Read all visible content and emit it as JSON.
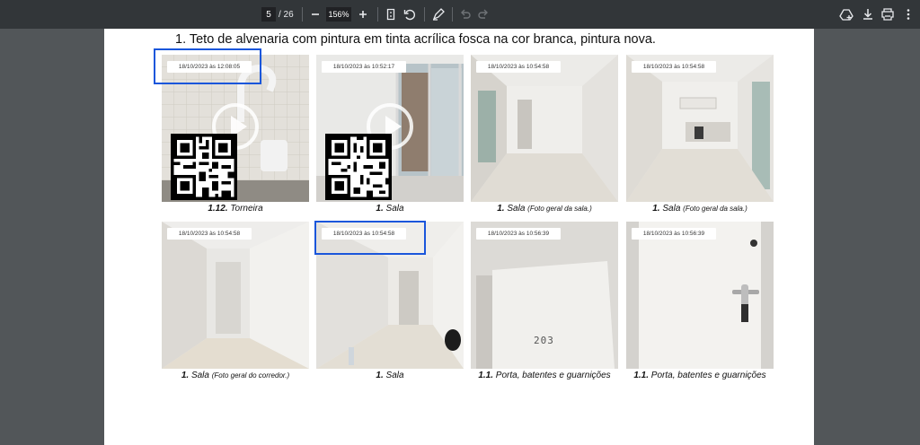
{
  "toolbar": {
    "current_page": "5",
    "page_total": "/ 26",
    "zoom": "156%",
    "icons": [
      "menu-icon",
      "zoom-out-icon",
      "zoom-in-icon",
      "fit-page-icon",
      "rotate-icon",
      "annotate-icon",
      "undo-icon",
      "redo-icon",
      "save-to-drive-icon",
      "download-icon",
      "print-icon",
      "more-options-icon"
    ]
  },
  "document": {
    "heading": "1. Teto de alvenaria com pintura em tinta acrílica fosca na cor branca, pintura nova.",
    "photos": [
      {
        "timestamp": "18/10/2023 às 12:08:05",
        "num": "1.12.",
        "title": "Torneira",
        "sub": ""
      },
      {
        "timestamp": "18/10/2023 às 10:52:17",
        "num": "1.",
        "title": "Sala",
        "sub": ""
      },
      {
        "timestamp": "18/10/2023 às 10:54:58",
        "num": "1.",
        "title": "Sala",
        "sub": "(Foto geral da sala.)"
      },
      {
        "timestamp": "18/10/2023 às 10:54:58",
        "num": "1.",
        "title": "Sala",
        "sub": "(Foto geral da sala.)"
      },
      {
        "timestamp": "18/10/2023 às 10:54:58",
        "num": "1.",
        "title": "Sala",
        "sub": "(Foto geral do corredor.)"
      },
      {
        "timestamp": "18/10/2023 às 10:54:58",
        "num": "1.",
        "title": "Sala",
        "sub": ""
      },
      {
        "timestamp": "18/10/2023 às 10:56:39",
        "num": "1.1.",
        "title": "Porta, batentes e guarnições",
        "sub": ""
      },
      {
        "timestamp": "18/10/2023 às 10:56:39",
        "num": "1.1.",
        "title": "Porta, batentes e guarnições",
        "sub": ""
      }
    ],
    "door_number": "203"
  },
  "colors": {
    "toolbar_bg": "#323639",
    "viewer_bg": "#525659",
    "highlight": "#1a56db"
  }
}
